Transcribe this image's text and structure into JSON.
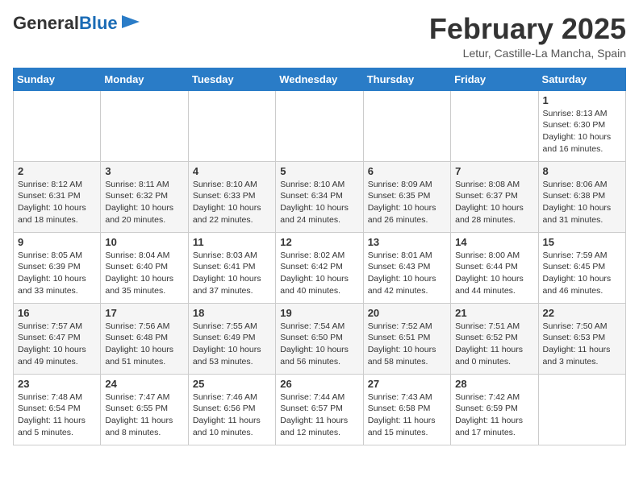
{
  "header": {
    "logo_general": "General",
    "logo_blue": "Blue",
    "month_title": "February 2025",
    "location": "Letur, Castille-La Mancha, Spain"
  },
  "days_of_week": [
    "Sunday",
    "Monday",
    "Tuesday",
    "Wednesday",
    "Thursday",
    "Friday",
    "Saturday"
  ],
  "weeks": [
    [
      {
        "day": "",
        "info": ""
      },
      {
        "day": "",
        "info": ""
      },
      {
        "day": "",
        "info": ""
      },
      {
        "day": "",
        "info": ""
      },
      {
        "day": "",
        "info": ""
      },
      {
        "day": "",
        "info": ""
      },
      {
        "day": "1",
        "info": "Sunrise: 8:13 AM\nSunset: 6:30 PM\nDaylight: 10 hours and 16 minutes."
      }
    ],
    [
      {
        "day": "2",
        "info": "Sunrise: 8:12 AM\nSunset: 6:31 PM\nDaylight: 10 hours and 18 minutes."
      },
      {
        "day": "3",
        "info": "Sunrise: 8:11 AM\nSunset: 6:32 PM\nDaylight: 10 hours and 20 minutes."
      },
      {
        "day": "4",
        "info": "Sunrise: 8:10 AM\nSunset: 6:33 PM\nDaylight: 10 hours and 22 minutes."
      },
      {
        "day": "5",
        "info": "Sunrise: 8:10 AM\nSunset: 6:34 PM\nDaylight: 10 hours and 24 minutes."
      },
      {
        "day": "6",
        "info": "Sunrise: 8:09 AM\nSunset: 6:35 PM\nDaylight: 10 hours and 26 minutes."
      },
      {
        "day": "7",
        "info": "Sunrise: 8:08 AM\nSunset: 6:37 PM\nDaylight: 10 hours and 28 minutes."
      },
      {
        "day": "8",
        "info": "Sunrise: 8:06 AM\nSunset: 6:38 PM\nDaylight: 10 hours and 31 minutes."
      }
    ],
    [
      {
        "day": "9",
        "info": "Sunrise: 8:05 AM\nSunset: 6:39 PM\nDaylight: 10 hours and 33 minutes."
      },
      {
        "day": "10",
        "info": "Sunrise: 8:04 AM\nSunset: 6:40 PM\nDaylight: 10 hours and 35 minutes."
      },
      {
        "day": "11",
        "info": "Sunrise: 8:03 AM\nSunset: 6:41 PM\nDaylight: 10 hours and 37 minutes."
      },
      {
        "day": "12",
        "info": "Sunrise: 8:02 AM\nSunset: 6:42 PM\nDaylight: 10 hours and 40 minutes."
      },
      {
        "day": "13",
        "info": "Sunrise: 8:01 AM\nSunset: 6:43 PM\nDaylight: 10 hours and 42 minutes."
      },
      {
        "day": "14",
        "info": "Sunrise: 8:00 AM\nSunset: 6:44 PM\nDaylight: 10 hours and 44 minutes."
      },
      {
        "day": "15",
        "info": "Sunrise: 7:59 AM\nSunset: 6:45 PM\nDaylight: 10 hours and 46 minutes."
      }
    ],
    [
      {
        "day": "16",
        "info": "Sunrise: 7:57 AM\nSunset: 6:47 PM\nDaylight: 10 hours and 49 minutes."
      },
      {
        "day": "17",
        "info": "Sunrise: 7:56 AM\nSunset: 6:48 PM\nDaylight: 10 hours and 51 minutes."
      },
      {
        "day": "18",
        "info": "Sunrise: 7:55 AM\nSunset: 6:49 PM\nDaylight: 10 hours and 53 minutes."
      },
      {
        "day": "19",
        "info": "Sunrise: 7:54 AM\nSunset: 6:50 PM\nDaylight: 10 hours and 56 minutes."
      },
      {
        "day": "20",
        "info": "Sunrise: 7:52 AM\nSunset: 6:51 PM\nDaylight: 10 hours and 58 minutes."
      },
      {
        "day": "21",
        "info": "Sunrise: 7:51 AM\nSunset: 6:52 PM\nDaylight: 11 hours and 0 minutes."
      },
      {
        "day": "22",
        "info": "Sunrise: 7:50 AM\nSunset: 6:53 PM\nDaylight: 11 hours and 3 minutes."
      }
    ],
    [
      {
        "day": "23",
        "info": "Sunrise: 7:48 AM\nSunset: 6:54 PM\nDaylight: 11 hours and 5 minutes."
      },
      {
        "day": "24",
        "info": "Sunrise: 7:47 AM\nSunset: 6:55 PM\nDaylight: 11 hours and 8 minutes."
      },
      {
        "day": "25",
        "info": "Sunrise: 7:46 AM\nSunset: 6:56 PM\nDaylight: 11 hours and 10 minutes."
      },
      {
        "day": "26",
        "info": "Sunrise: 7:44 AM\nSunset: 6:57 PM\nDaylight: 11 hours and 12 minutes."
      },
      {
        "day": "27",
        "info": "Sunrise: 7:43 AM\nSunset: 6:58 PM\nDaylight: 11 hours and 15 minutes."
      },
      {
        "day": "28",
        "info": "Sunrise: 7:42 AM\nSunset: 6:59 PM\nDaylight: 11 hours and 17 minutes."
      },
      {
        "day": "",
        "info": ""
      }
    ]
  ]
}
